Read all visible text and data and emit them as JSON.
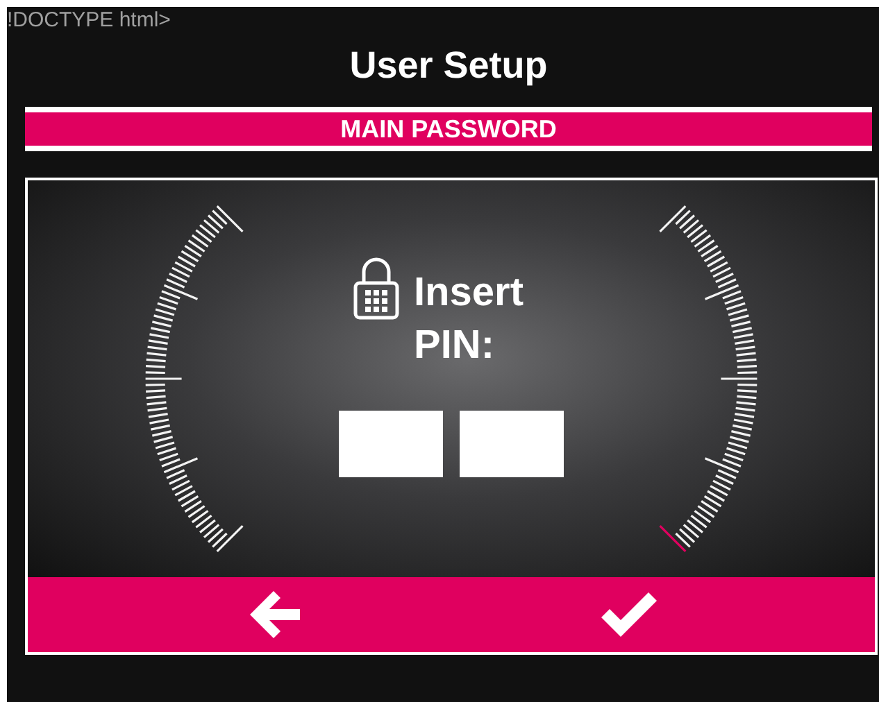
{
  "doc_text": "!DOCTYPE html>",
  "title": "User Setup",
  "section_banner": "MAIN PASSWORD",
  "prompt": "Insert PIN:",
  "pin_fields": [
    {
      "kind": "digit"
    },
    {
      "kind": "digit"
    }
  ],
  "footer_buttons": [
    {
      "kind": "back"
    },
    {
      "kind": "confirm"
    }
  ]
}
